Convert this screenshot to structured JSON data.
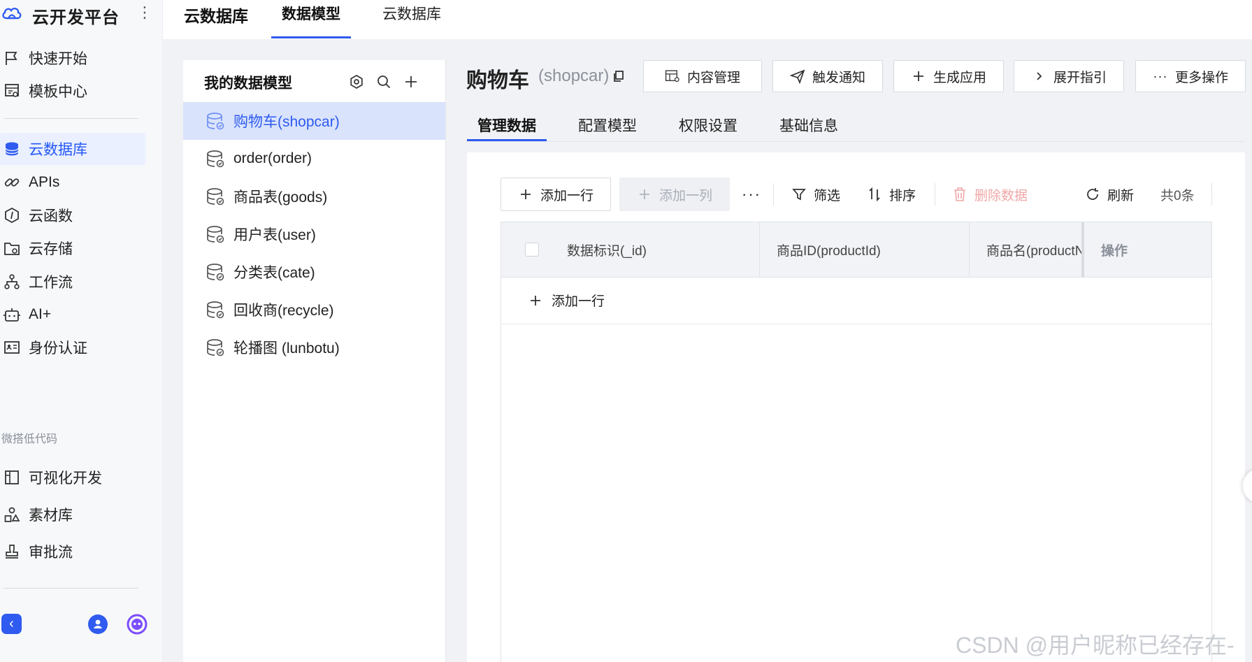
{
  "colors": {
    "accent": "#2f5bf0",
    "accent_bg": "#d9e3fc",
    "sidebar_bg": "#f7f8fa",
    "work_bg": "#f1f2f5",
    "danger_muted": "#f0a7a7"
  },
  "sidebar": {
    "title": "云开发平台",
    "items_top": [
      {
        "label": "快速开始",
        "icon": "flag-icon"
      },
      {
        "label": "模板中心",
        "icon": "template-icon"
      }
    ],
    "items_main": [
      {
        "label": "云数据库",
        "icon": "database-icon",
        "active": true
      },
      {
        "label": "APIs",
        "icon": "link-icon"
      },
      {
        "label": "云函数",
        "icon": "function-icon"
      },
      {
        "label": "云存储",
        "icon": "storage-icon"
      },
      {
        "label": "工作流",
        "icon": "workflow-icon"
      },
      {
        "label": "AI+",
        "icon": "robot-icon"
      },
      {
        "label": "身份认证",
        "icon": "id-card-icon"
      }
    ],
    "section_label": "微搭低代码",
    "items_lowcode": [
      {
        "label": "可视化开发",
        "icon": "layout-icon"
      },
      {
        "label": "素材库",
        "icon": "shapes-icon"
      },
      {
        "label": "审批流",
        "icon": "stamp-icon"
      }
    ]
  },
  "topbar": {
    "title": "云数据库",
    "tabs": [
      {
        "label": "数据模型",
        "active": true
      },
      {
        "label": "云数据库",
        "active": false
      }
    ]
  },
  "model_panel": {
    "title": "我的数据模型",
    "items": [
      {
        "label": "购物车(shopcar)",
        "active": true
      },
      {
        "label": "order(order)"
      },
      {
        "label": "商品表(goods)"
      },
      {
        "label": "用户表(user)"
      },
      {
        "label": "分类表(cate)"
      },
      {
        "label": "回收商(recycle)"
      },
      {
        "label": "轮播图 (lunbotu)"
      }
    ]
  },
  "detail": {
    "title": "购物车",
    "subtitle": "(shopcar)",
    "actions": [
      {
        "label": "内容管理",
        "icon": "table-cog-icon"
      },
      {
        "label": "触发通知",
        "icon": "send-icon"
      },
      {
        "label": "生成应用",
        "icon": "plus-icon"
      },
      {
        "label": "展开指引",
        "icon": "chevron-right-icon"
      },
      {
        "label": "更多操作",
        "icon": "more-icon"
      }
    ],
    "tabs": [
      {
        "label": "管理数据",
        "active": true
      },
      {
        "label": "配置模型"
      },
      {
        "label": "权限设置"
      },
      {
        "label": "基础信息"
      }
    ]
  },
  "toolbar": {
    "add_row": "添加一行",
    "add_col": "添加一列",
    "filter": "筛选",
    "sort": "排序",
    "delete": "删除数据",
    "refresh": "刷新",
    "total": "共0条"
  },
  "grid": {
    "columns": [
      "数据标识(_id)",
      "商品ID(productId)",
      "商品名(productNa",
      "操作"
    ],
    "add_row": "添加一行",
    "rows": []
  },
  "watermark": "CSDN @用户昵称已经存在-"
}
